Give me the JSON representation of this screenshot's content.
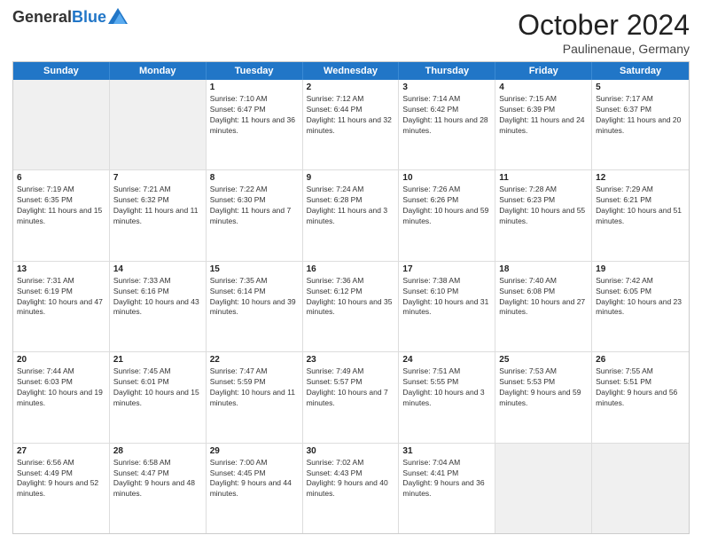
{
  "header": {
    "logo_line1": "General",
    "logo_line2": "Blue",
    "month_title": "October 2024",
    "subtitle": "Paulinenaue, Germany"
  },
  "weekdays": [
    "Sunday",
    "Monday",
    "Tuesday",
    "Wednesday",
    "Thursday",
    "Friday",
    "Saturday"
  ],
  "rows": [
    [
      {
        "day": "",
        "info": ""
      },
      {
        "day": "",
        "info": ""
      },
      {
        "day": "1",
        "info": "Sunrise: 7:10 AM\nSunset: 6:47 PM\nDaylight: 11 hours and 36 minutes."
      },
      {
        "day": "2",
        "info": "Sunrise: 7:12 AM\nSunset: 6:44 PM\nDaylight: 11 hours and 32 minutes."
      },
      {
        "day": "3",
        "info": "Sunrise: 7:14 AM\nSunset: 6:42 PM\nDaylight: 11 hours and 28 minutes."
      },
      {
        "day": "4",
        "info": "Sunrise: 7:15 AM\nSunset: 6:39 PM\nDaylight: 11 hours and 24 minutes."
      },
      {
        "day": "5",
        "info": "Sunrise: 7:17 AM\nSunset: 6:37 PM\nDaylight: 11 hours and 20 minutes."
      }
    ],
    [
      {
        "day": "6",
        "info": "Sunrise: 7:19 AM\nSunset: 6:35 PM\nDaylight: 11 hours and 15 minutes."
      },
      {
        "day": "7",
        "info": "Sunrise: 7:21 AM\nSunset: 6:32 PM\nDaylight: 11 hours and 11 minutes."
      },
      {
        "day": "8",
        "info": "Sunrise: 7:22 AM\nSunset: 6:30 PM\nDaylight: 11 hours and 7 minutes."
      },
      {
        "day": "9",
        "info": "Sunrise: 7:24 AM\nSunset: 6:28 PM\nDaylight: 11 hours and 3 minutes."
      },
      {
        "day": "10",
        "info": "Sunrise: 7:26 AM\nSunset: 6:26 PM\nDaylight: 10 hours and 59 minutes."
      },
      {
        "day": "11",
        "info": "Sunrise: 7:28 AM\nSunset: 6:23 PM\nDaylight: 10 hours and 55 minutes."
      },
      {
        "day": "12",
        "info": "Sunrise: 7:29 AM\nSunset: 6:21 PM\nDaylight: 10 hours and 51 minutes."
      }
    ],
    [
      {
        "day": "13",
        "info": "Sunrise: 7:31 AM\nSunset: 6:19 PM\nDaylight: 10 hours and 47 minutes."
      },
      {
        "day": "14",
        "info": "Sunrise: 7:33 AM\nSunset: 6:16 PM\nDaylight: 10 hours and 43 minutes."
      },
      {
        "day": "15",
        "info": "Sunrise: 7:35 AM\nSunset: 6:14 PM\nDaylight: 10 hours and 39 minutes."
      },
      {
        "day": "16",
        "info": "Sunrise: 7:36 AM\nSunset: 6:12 PM\nDaylight: 10 hours and 35 minutes."
      },
      {
        "day": "17",
        "info": "Sunrise: 7:38 AM\nSunset: 6:10 PM\nDaylight: 10 hours and 31 minutes."
      },
      {
        "day": "18",
        "info": "Sunrise: 7:40 AM\nSunset: 6:08 PM\nDaylight: 10 hours and 27 minutes."
      },
      {
        "day": "19",
        "info": "Sunrise: 7:42 AM\nSunset: 6:05 PM\nDaylight: 10 hours and 23 minutes."
      }
    ],
    [
      {
        "day": "20",
        "info": "Sunrise: 7:44 AM\nSunset: 6:03 PM\nDaylight: 10 hours and 19 minutes."
      },
      {
        "day": "21",
        "info": "Sunrise: 7:45 AM\nSunset: 6:01 PM\nDaylight: 10 hours and 15 minutes."
      },
      {
        "day": "22",
        "info": "Sunrise: 7:47 AM\nSunset: 5:59 PM\nDaylight: 10 hours and 11 minutes."
      },
      {
        "day": "23",
        "info": "Sunrise: 7:49 AM\nSunset: 5:57 PM\nDaylight: 10 hours and 7 minutes."
      },
      {
        "day": "24",
        "info": "Sunrise: 7:51 AM\nSunset: 5:55 PM\nDaylight: 10 hours and 3 minutes."
      },
      {
        "day": "25",
        "info": "Sunrise: 7:53 AM\nSunset: 5:53 PM\nDaylight: 9 hours and 59 minutes."
      },
      {
        "day": "26",
        "info": "Sunrise: 7:55 AM\nSunset: 5:51 PM\nDaylight: 9 hours and 56 minutes."
      }
    ],
    [
      {
        "day": "27",
        "info": "Sunrise: 6:56 AM\nSunset: 4:49 PM\nDaylight: 9 hours and 52 minutes."
      },
      {
        "day": "28",
        "info": "Sunrise: 6:58 AM\nSunset: 4:47 PM\nDaylight: 9 hours and 48 minutes."
      },
      {
        "day": "29",
        "info": "Sunrise: 7:00 AM\nSunset: 4:45 PM\nDaylight: 9 hours and 44 minutes."
      },
      {
        "day": "30",
        "info": "Sunrise: 7:02 AM\nSunset: 4:43 PM\nDaylight: 9 hours and 40 minutes."
      },
      {
        "day": "31",
        "info": "Sunrise: 7:04 AM\nSunset: 4:41 PM\nDaylight: 9 hours and 36 minutes."
      },
      {
        "day": "",
        "info": ""
      },
      {
        "day": "",
        "info": ""
      }
    ]
  ]
}
